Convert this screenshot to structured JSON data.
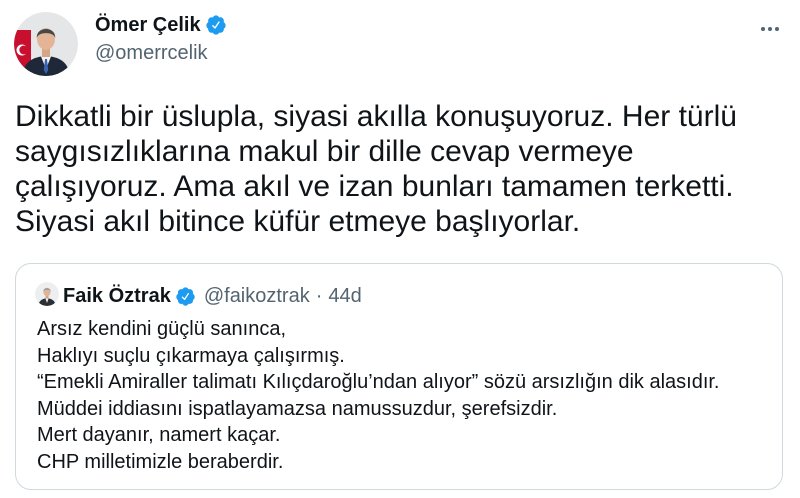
{
  "tweet": {
    "author": {
      "name": "Ömer Çelik",
      "handle": "@omerrcelik",
      "verified": true,
      "avatar_icon": "profile-photo-icon",
      "verified_icon": "verified-badge-icon"
    },
    "more_icon": "more-horizontal-icon",
    "text_lines": [
      "Dikkatli bir üslupla, siyasi akılla konuşuyoruz. Her türlü",
      "saygısızlıklarına makul bir dille cevap vermeye",
      "çalışıyoruz. Ama akıl ve izan bunları tamamen terketti.",
      "Siyasi akıl bitince küfür etmeye başlıyorlar."
    ],
    "quoted": {
      "author": {
        "name": "Faik Öztrak",
        "handle": "@faikoztrak",
        "verified": true,
        "avatar_icon": "profile-photo-icon",
        "verified_icon": "verified-badge-icon"
      },
      "separator": "·",
      "time": "44d",
      "text_lines": [
        "Arsız kendini güçlü sanınca,",
        "Haklıyı suçlu çıkarmaya çalışırmış.",
        "“Emekli Amiraller talimatı Kılıçdaroğlu’ndan alıyor” sözü arsızlığın dik alasıdır.",
        "Müddei iddiasını ispatlayamazsa namussuzdur, şerefsizdir.",
        "Mert dayanır, namert kaçar.",
        "CHP milletimizle beraberdir."
      ]
    }
  },
  "colors": {
    "background": "#ffffff",
    "primary_text": "#0f1419",
    "secondary_text": "#536471",
    "verified_blue": "#1d9bf0",
    "card_border": "#cfd9de"
  }
}
